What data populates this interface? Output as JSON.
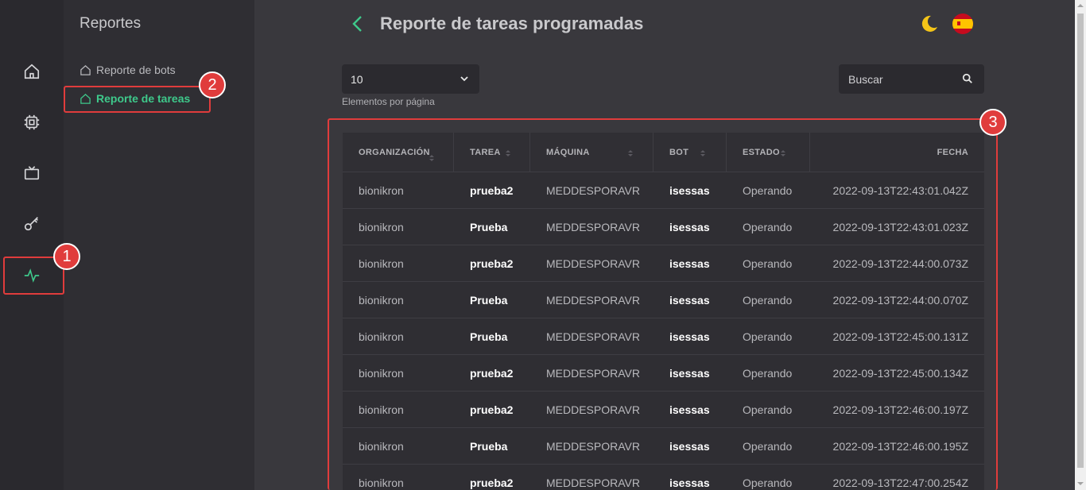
{
  "nav_rail": {
    "items": [
      {
        "icon": "home-icon"
      },
      {
        "icon": "chip-icon"
      },
      {
        "icon": "tv-icon"
      },
      {
        "icon": "key-icon"
      },
      {
        "icon": "activity-icon"
      }
    ]
  },
  "sidebar": {
    "title": "Reportes",
    "items": [
      {
        "label": "Reporte de bots",
        "icon": "home-outline-icon"
      },
      {
        "label": "Reporte de tareas",
        "icon": "home-outline-icon"
      }
    ]
  },
  "header": {
    "title": "Reporte de tareas programadas"
  },
  "controls": {
    "page_size": "10",
    "page_size_label": "Elementos por página",
    "search_placeholder": "Buscar"
  },
  "table": {
    "columns": [
      "ORGANIZACIÓN",
      "TAREA",
      "MÁQUINA",
      "BOT",
      "ESTADO",
      "FECHA"
    ],
    "rows": [
      [
        "bionikron",
        "prueba2",
        "MEDDESPORAVR",
        "isessas",
        "Operando",
        "2022-09-13T22:43:01.042Z"
      ],
      [
        "bionikron",
        "Prueba",
        "MEDDESPORAVR",
        "isessas",
        "Operando",
        "2022-09-13T22:43:01.023Z"
      ],
      [
        "bionikron",
        "prueba2",
        "MEDDESPORAVR",
        "isessas",
        "Operando",
        "2022-09-13T22:44:00.073Z"
      ],
      [
        "bionikron",
        "Prueba",
        "MEDDESPORAVR",
        "isessas",
        "Operando",
        "2022-09-13T22:44:00.070Z"
      ],
      [
        "bionikron",
        "Prueba",
        "MEDDESPORAVR",
        "isessas",
        "Operando",
        "2022-09-13T22:45:00.131Z"
      ],
      [
        "bionikron",
        "prueba2",
        "MEDDESPORAVR",
        "isessas",
        "Operando",
        "2022-09-13T22:45:00.134Z"
      ],
      [
        "bionikron",
        "prueba2",
        "MEDDESPORAVR",
        "isessas",
        "Operando",
        "2022-09-13T22:46:00.197Z"
      ],
      [
        "bionikron",
        "Prueba",
        "MEDDESPORAVR",
        "isessas",
        "Operando",
        "2022-09-13T22:46:00.195Z"
      ],
      [
        "bionikron",
        "prueba2",
        "MEDDESPORAVR",
        "isessas",
        "Operando",
        "2022-09-13T22:47:00.254Z"
      ]
    ]
  },
  "annotations": [
    "1",
    "2",
    "3"
  ],
  "colors": {
    "accent": "#3ec98b",
    "highlight": "#e03c3c",
    "background": "#39383d"
  }
}
